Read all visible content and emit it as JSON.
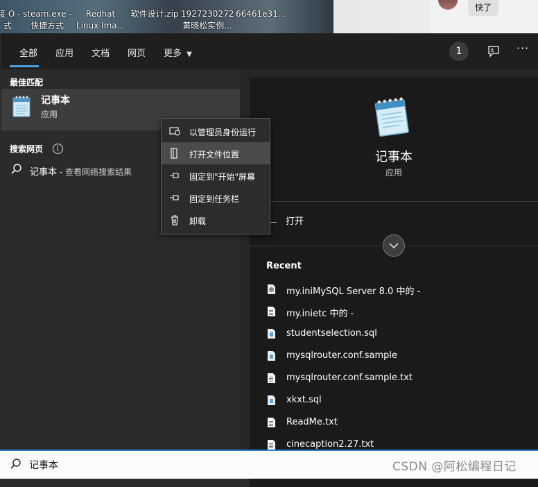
{
  "desktop": {
    "icons": [
      {
        "line1": "接 O -",
        "line2": "式"
      },
      {
        "line1": "steam.exe -",
        "line2": "快捷方式"
      },
      {
        "line1": "Redhat",
        "line2": "Linux Ima..."
      },
      {
        "line1": "软件设计.zip",
        "line2": ""
      },
      {
        "line1": "1927230272",
        "line2": "黄晓松实例..."
      },
      {
        "line1": "66461e31...",
        "line2": ""
      }
    ],
    "chat_bubble": "快了"
  },
  "tabs": [
    {
      "label": "全部"
    },
    {
      "label": "应用"
    },
    {
      "label": "文档"
    },
    {
      "label": "网页"
    },
    {
      "label": "更多"
    }
  ],
  "header": {
    "badge": "1",
    "more_dots": "···"
  },
  "left": {
    "best_match_heading": "最佳匹配",
    "best_match": {
      "title": "记事本",
      "subtitle": "应用"
    },
    "web_heading": "搜索网页",
    "web_result": {
      "query": "记事本",
      "suffix": " - 查看网络搜索结果"
    }
  },
  "context_menu": [
    {
      "label": "以管理员身份运行",
      "icon": "run-as-admin-icon"
    },
    {
      "label": "打开文件位置",
      "icon": "open-folder-icon"
    },
    {
      "label": "固定到\"开始\"屏幕",
      "icon": "pin-icon"
    },
    {
      "label": "固定到任务栏",
      "icon": "pin-icon"
    },
    {
      "label": "卸载",
      "icon": "trash-icon"
    }
  ],
  "right": {
    "title": "记事本",
    "subtitle": "应用",
    "open_label": "打开",
    "recent_heading": "Recent",
    "recent": [
      {
        "name": "my.iniMySQL Server 8.0 中的 -",
        "type": "cfg"
      },
      {
        "name": "my.inietc 中的 -",
        "type": "txt"
      },
      {
        "name": "studentselection.sql",
        "type": "sql"
      },
      {
        "name": "mysqlrouter.conf.sample",
        "type": "sql"
      },
      {
        "name": "mysqlrouter.conf.sample.txt",
        "type": "txt"
      },
      {
        "name": "xkxt.sql",
        "type": "sql"
      },
      {
        "name": "ReadMe.txt",
        "type": "txt"
      },
      {
        "name": "cinecaption2.27.txt",
        "type": "txt"
      }
    ]
  },
  "search": {
    "value": "记事本"
  },
  "watermark": "CSDN @阿松编程日记"
}
